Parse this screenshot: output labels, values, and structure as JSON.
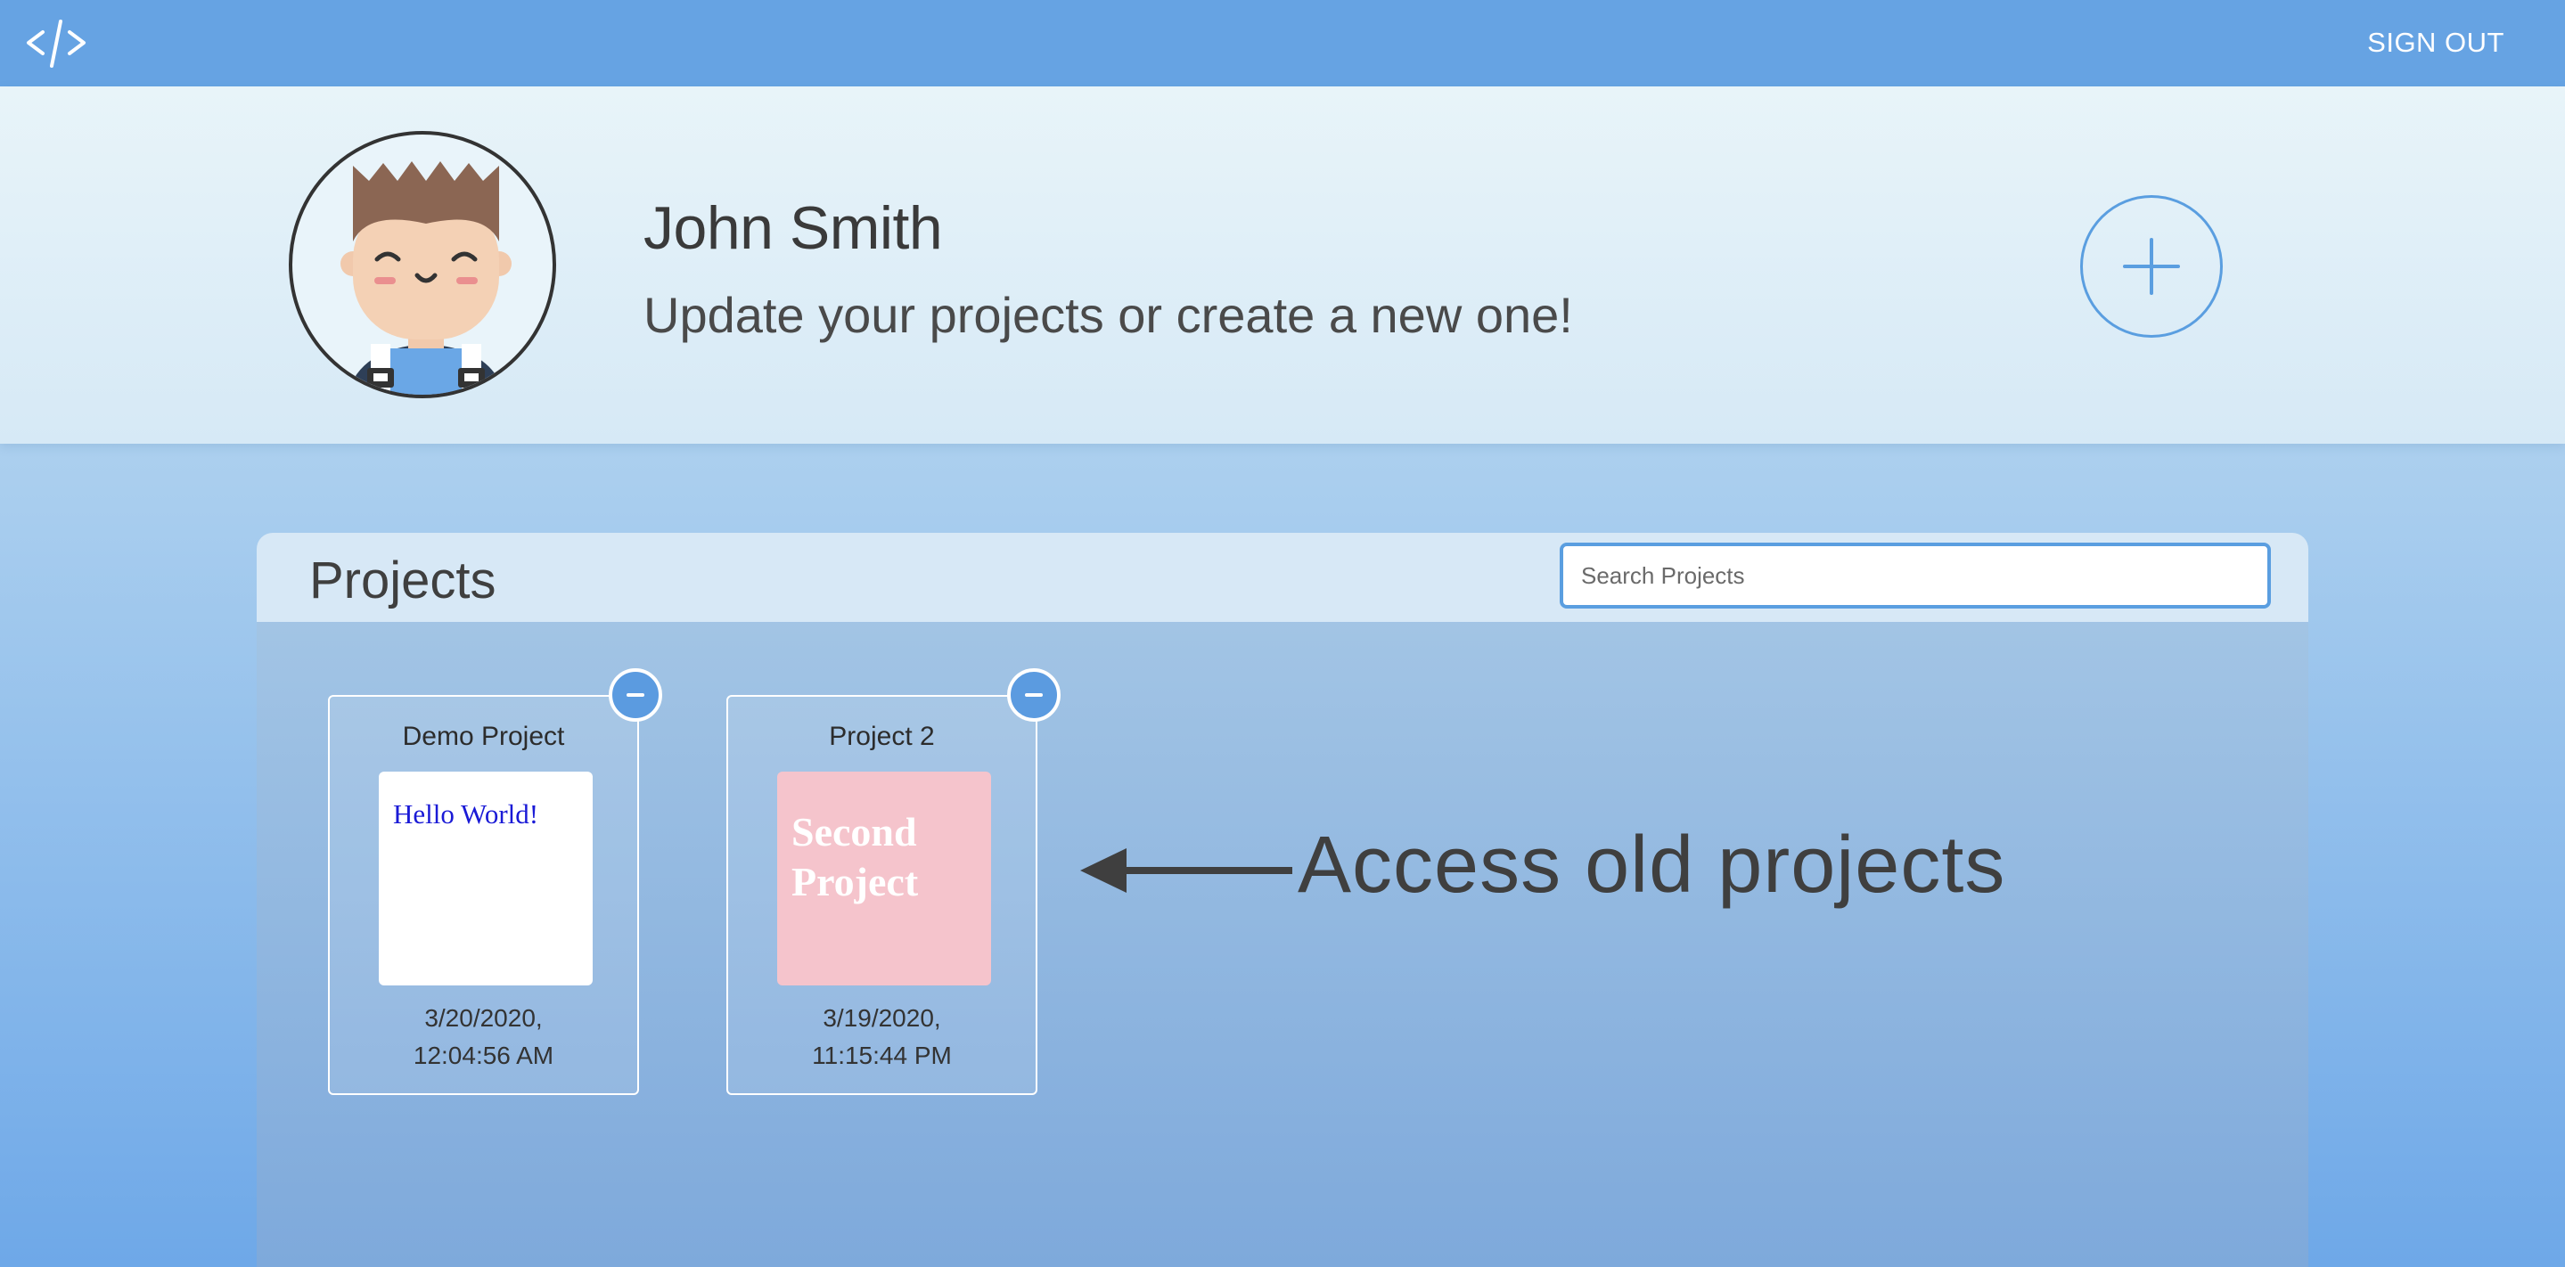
{
  "nav": {
    "logo_icon": "code-brackets-icon",
    "signout_label": "SIGN OUT"
  },
  "profile": {
    "avatar_icon": "user-avatar",
    "name": "John Smith",
    "tagline": "Update your projects or create a new one!",
    "add_icon": "plus-icon"
  },
  "projects": {
    "title": "Projects",
    "search_placeholder": "Search Projects",
    "search_value": "",
    "items": [
      {
        "title": "Demo Project",
        "preview_text": "Hello World!",
        "preview_bg": "#ffffff",
        "preview_color": "#1a1ad6",
        "date_line1": "3/20/2020,",
        "date_line2": "12:04:56 AM",
        "remove_icon": "minus-icon"
      },
      {
        "title": "Project 2",
        "preview_text": "Second Project",
        "preview_bg": "#f5c4cc",
        "preview_color": "#ffffff",
        "date_line1": "3/19/2020,",
        "date_line2": "11:15:44 PM",
        "remove_icon": "minus-icon"
      }
    ]
  },
  "annotation": {
    "text": "Access old projects",
    "arrow_icon": "arrow-left-icon"
  },
  "colors": {
    "nav_bg": "#66a3e3",
    "accent": "#5a9ee0",
    "text_dark": "#3a3a3a"
  }
}
